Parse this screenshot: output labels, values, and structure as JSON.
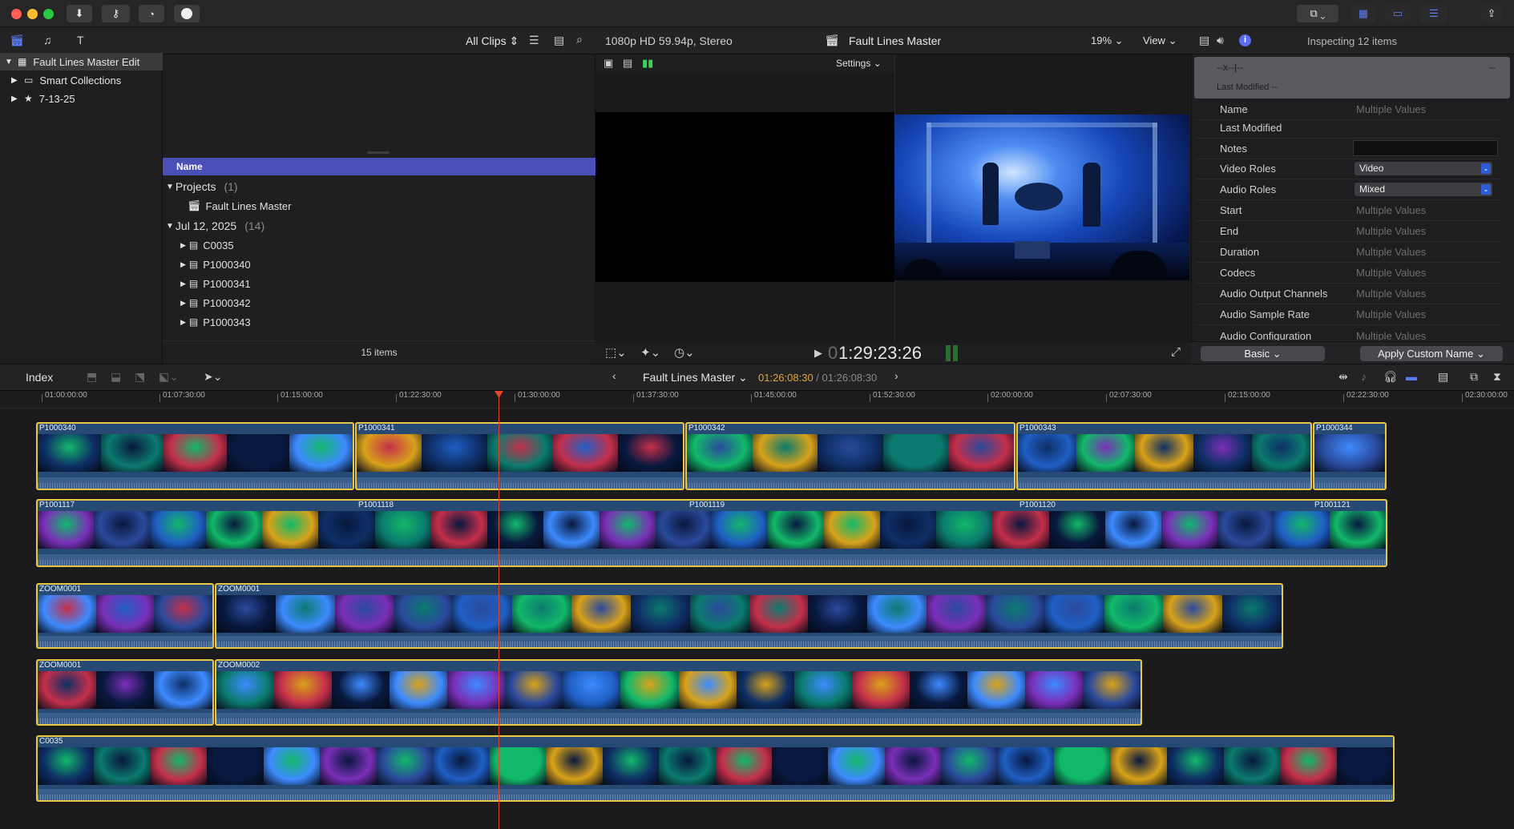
{
  "toolbar": {
    "import_icon": "download-icon",
    "keywords_icon": "key-icon",
    "background_tasks_icon": "progress-icon",
    "check_icon": "circle-icon"
  },
  "library": {
    "items": [
      {
        "label": "Fault Lines Master Edit",
        "expanded": true
      },
      {
        "label": "Smart Collections",
        "expanded": false
      },
      {
        "label": "7-13-25",
        "expanded": false
      }
    ]
  },
  "browser": {
    "filter_label": "All Clips",
    "column_header": "Name",
    "groups": [
      {
        "label": "Projects",
        "count": "(1)",
        "items": [
          "Fault Lines Master"
        ]
      },
      {
        "label": "Jul 12, 2025",
        "count": "(14)",
        "items": [
          "C0035",
          "P1000340",
          "P1000341",
          "P1000342",
          "P1000343"
        ]
      }
    ],
    "footer": "15 items"
  },
  "viewer": {
    "format": "1080p HD 59.94p, Stereo",
    "project_title": "Fault Lines Master",
    "zoom": "19%",
    "view_label": "View",
    "settings_label": "Settings",
    "timecode_prefix": "0",
    "timecode": "1:29:23:26"
  },
  "inspector": {
    "inspecting": "Inspecting 12 items",
    "summary_name": "--x--|--",
    "summary_dash": "--",
    "summary_modified": "Last Modified --",
    "rows": [
      {
        "label": "Name",
        "value": "Multiple Values",
        "kind": "text"
      },
      {
        "label": "Last Modified",
        "value": "",
        "kind": "text"
      },
      {
        "label": "Notes",
        "value": "",
        "kind": "field"
      },
      {
        "label": "Video Roles",
        "value": "Video",
        "kind": "popup"
      },
      {
        "label": "Audio Roles",
        "value": "Mixed",
        "kind": "popup"
      },
      {
        "label": "Start",
        "value": "Multiple Values",
        "kind": "text"
      },
      {
        "label": "End",
        "value": "Multiple Values",
        "kind": "text"
      },
      {
        "label": "Duration",
        "value": "Multiple Values",
        "kind": "text"
      },
      {
        "label": "Codecs",
        "value": "Multiple Values",
        "kind": "text"
      },
      {
        "label": "Audio Output Channels",
        "value": "Multiple Values",
        "kind": "text"
      },
      {
        "label": "Audio Sample Rate",
        "value": "Multiple Values",
        "kind": "text"
      },
      {
        "label": "Audio Configuration",
        "value": "Multiple Values",
        "kind": "text"
      }
    ],
    "basic_label": "Basic",
    "apply_label": "Apply Custom Name"
  },
  "timeline": {
    "index_label": "Index",
    "project_name": "Fault Lines Master",
    "tc_current": "01:26:08:30",
    "tc_separator": " / ",
    "tc_total": "01:26:08:30",
    "ruler": [
      "01:00:00:00",
      "01:07:30:00",
      "01:15:00:00",
      "01:22:30:00",
      "01:30:00:00",
      "01:37:30:00",
      "01:45:00:00",
      "01:52:30:00",
      "02:00:00:00",
      "02:07:30:00",
      "02:15:00:00",
      "02:22:30:00",
      "02:30:00:00"
    ],
    "lanes": [
      [
        "P1000340",
        "P1000341",
        "P1000342",
        "P1000343",
        "P1000344"
      ],
      [
        "P1001117",
        "P1001118",
        "P1001119",
        "P1001120",
        "P1001121"
      ],
      [
        "ZOOM0001",
        "ZOOM0001"
      ],
      [
        "ZOOM0001",
        "ZOOM0002"
      ],
      [
        "C0035"
      ]
    ]
  },
  "colors": {
    "accent_blue": "#2f5bd6",
    "selection_yellow": "#e8c744",
    "playhead_red": "#e0452c",
    "browser_header": "#4b4fb8"
  }
}
